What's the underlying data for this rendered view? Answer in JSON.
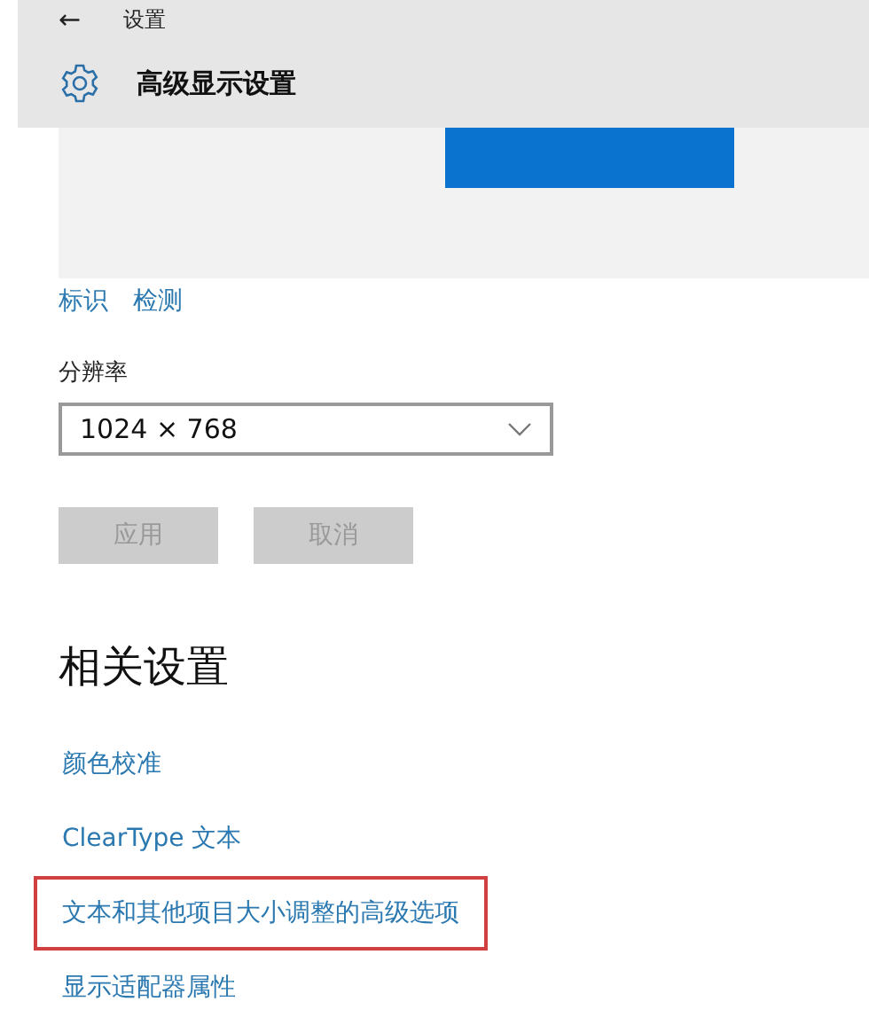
{
  "header": {
    "back": "←",
    "title": "设置",
    "page_title": "高级显示设置"
  },
  "display_links": [
    {
      "label": "标识"
    },
    {
      "label": "检测"
    }
  ],
  "resolution": {
    "label": "分辨率",
    "value": "1024 × 768"
  },
  "buttons": [
    {
      "label": "应用",
      "disabled": true
    },
    {
      "label": "取消",
      "disabled": true
    }
  ],
  "related": {
    "heading": "相关设置",
    "links": [
      {
        "label": "颜色校准",
        "highlighted": false
      },
      {
        "label": "ClearType 文本",
        "highlighted": false
      },
      {
        "label": "文本和其他项目大小调整的高级选项",
        "highlighted": true
      },
      {
        "label": "显示适配器属性",
        "highlighted": false
      }
    ]
  }
}
